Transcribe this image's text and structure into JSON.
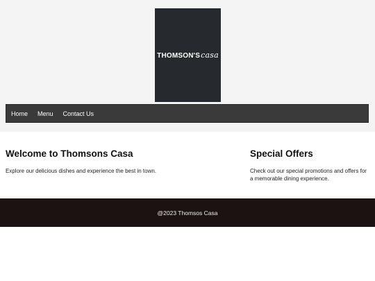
{
  "logo": {
    "brand": "THOMSON'S",
    "script": "casa"
  },
  "nav": {
    "items": [
      "Home",
      "Menu",
      "Contact Us"
    ]
  },
  "welcome": {
    "title": "Welcome to Thomsons Casa",
    "text": "Explore our delicious dishes and experience the best in town."
  },
  "offers": {
    "title": "Special Offers",
    "text": "Check out our special promotions and offers for a memorable dining experience."
  },
  "footer": {
    "text": "@2023 Thomsos Casa"
  },
  "colors": {
    "header_bg": "#f4f4f4",
    "logo_bg": "#26292d",
    "nav_bg": "#3a3a3a",
    "footer_bg": "#1c1212"
  }
}
